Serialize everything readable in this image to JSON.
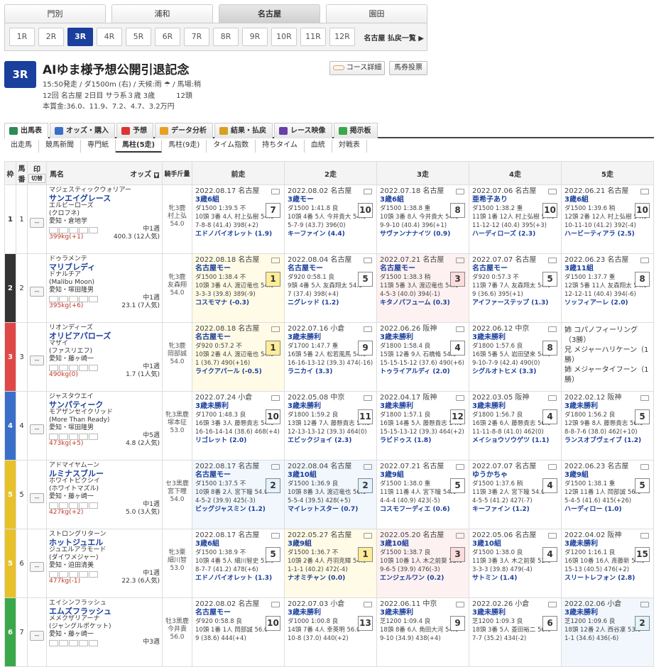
{
  "venue_tabs": [
    "門別",
    "浦和",
    "名古屋",
    "園田"
  ],
  "active_venue": 2,
  "races": [
    "1R",
    "2R",
    "3R",
    "4R",
    "5R",
    "6R",
    "7R",
    "8R",
    "9R",
    "10R",
    "11R",
    "12R"
  ],
  "active_race": 2,
  "payout_link": "名古屋 払戻一覧 ▶",
  "race": {
    "num": "3R",
    "name": "AIゆま様予想公開引退記念",
    "line1": "15:50発走 / ダ1500m (右) / 天候:雨 ☂ / 馬場:稍",
    "line2": "12回 名古屋 2日目 サラ系３歳 3歳　　　12頭",
    "line3": "本賞金:36.0、11.9、7.2、4.7、3.2万円"
  },
  "side_buttons": {
    "course": "コース詳細",
    "ticket": "馬券投票"
  },
  "main_tabs": [
    "出馬表",
    "オッズ・購入",
    "予想",
    "データ分析",
    "結果・払戻",
    "レース映像",
    "掲示板"
  ],
  "sub_tabs": [
    "出走馬",
    "競馬新聞",
    "専門紙",
    "馬柱(5走)",
    "馬柱(9走)",
    "タイム指数",
    "持ちタイム",
    "血統",
    "対戦表"
  ],
  "headers": {
    "waku": "枠",
    "umaban": "馬番",
    "mark": "印",
    "mark2": "切替",
    "horse": "馬名",
    "odds": "オッズ",
    "jockey": "騎手斤量",
    "p1": "前走",
    "p2": "2走",
    "p3": "3走",
    "p4": "4走",
    "p5": "5走"
  },
  "horses": [
    {
      "waku": "1",
      "wcol": "#ffffff",
      "wtxt": "#333",
      "no": "1",
      "sire": "マジェスティックウォリアー",
      "name": "サンエイグレース",
      "dam": "エルビーローズ",
      "damsire": "(クロフネ)",
      "trainer": "愛知・倉地学",
      "week": "中1週",
      "weight": "399kg(+1)",
      "odds": "400.3 (12人気)",
      "jk": "牝3鹿",
      "jk2": "村上弘",
      "jk3": "54.0",
      "past": [
        {
          "bg": "",
          "date": "2022.08.17 名古屋",
          "cls": "3歳6組",
          "pos": "7",
          "l1": "ダ1500 1:39.5 不",
          "l2": "10頭 3番 4人 村上弘樹 54.0",
          "l3": "7-8-8 (41.4) 398(+2)",
          "w": "エドノバイオレット (1.9)"
        },
        {
          "bg": "",
          "date": "2022.08.02 名古屋",
          "cls": "3歳モー",
          "pos": "10",
          "l1": "ダ1500 1:41.8 良",
          "l2": "10頭 4番 5人 今井貴大 54.0",
          "l3": "5-7-9 (43.7) 396(0)",
          "w": "キーファイン (4.4)"
        },
        {
          "bg": "",
          "date": "2022.07.18 名古屋",
          "cls": "3歳6組",
          "pos": "8",
          "l1": "ダ1500 1:38.8 重",
          "l2": "10頭 3番 8人 今井貴大 54.0",
          "l3": "9-9-10 (40.4) 396(+1)",
          "w": "サヴァンナナイツ (0.9)"
        },
        {
          "bg": "",
          "date": "2022.07.06 名古屋",
          "cls": "亜希子あり",
          "pos": "10",
          "l1": "ダ1500 1:38.2 重",
          "l2": "11頭 1番 12人 村上弘樹 54.0",
          "l3": "11-12-12 (40.4) 395(+3)",
          "w": "ハーディローズ (2.3)"
        },
        {
          "bg": "",
          "date": "2022.06.21 名古屋",
          "cls": "3歳6組",
          "pos": "10",
          "l1": "ダ1500 1:39.6 稍",
          "l2": "12頭 2番 12人 村上弘樹 54.0",
          "l3": "10-11-10 (41.2) 392(-4)",
          "w": "ハービーティアラ (2.5)"
        }
      ]
    },
    {
      "waku": "2",
      "wcol": "#333333",
      "wtxt": "#fff",
      "no": "2",
      "sire": "ドゥラメンテ",
      "name": "マリブレディ",
      "dam": "ドナルチア",
      "damsire": "(Malibu Moon)",
      "trainer": "愛知・塚田隆男",
      "week": "中1週",
      "weight": "395kg(+6)",
      "odds": "23.1 (7人気)",
      "jk": "牝3鹿",
      "jk2": "友森翔",
      "jk3": "54.0",
      "past": [
        {
          "bg": "bg1",
          "date": "2022.08.18 名古屋",
          "cls": "名古屋モー",
          "pos": "1",
          "l1": "ダ1500 1:38.4 不",
          "l2": "10頭 3番 4人 渡辺竜也 54.0",
          "l3": "3-3-3 (39.8) 389(-9)",
          "w": "コスモマナ (-0.3)"
        },
        {
          "bg": "",
          "date": "2022.08.04 名古屋",
          "cls": "名古屋モー",
          "pos": "5",
          "l1": "ダ920 0:58.1 良",
          "l2": "9頭 4番 5人 友森翔太 54.0",
          "l3": "7 (37.4) 398(+4)",
          "w": "ニグレッド (1.2)"
        },
        {
          "bg": "bg3",
          "date": "2022.07.21 名古屋",
          "cls": "名古屋モー",
          "pos": "3",
          "l1": "ダ1500 1:38.3 稍",
          "l2": "11頭 5番 3人 渡辺竜也 54.0",
          "l3": "4-5-3 (40.0) 394(-1)",
          "w": "キタノパフューム (0.3)"
        },
        {
          "bg": "",
          "date": "2022.07.07 名古屋",
          "cls": "名古屋モー",
          "pos": "5",
          "l1": "ダ920 0:57.3 不",
          "l2": "11頭 7番 7人 友森翔太 54.0",
          "l3": "9 (36.6) 395(+1)",
          "w": "アイファーステップ (1.3)"
        },
        {
          "bg": "",
          "date": "2022.06.23 名古屋",
          "cls": "3歳11組",
          "pos": "8",
          "l1": "ダ1500 1:37.7 重",
          "l2": "12頭 5番 11人 友森翔太 54.0",
          "l3": "12-12-11 (40.4) 394(-6)",
          "w": "ソッフィアーレ (2.0)"
        }
      ]
    },
    {
      "waku": "3",
      "wcol": "#e04848",
      "wtxt": "#fff",
      "no": "3",
      "sire": "リオンディーズ",
      "name": "オリビアパローズ",
      "dam": "マザイ",
      "damsire": "(ファスリエフ)",
      "trainer": "愛知・藤ヶ崎一",
      "week": "中1週",
      "weight": "490kg(0)",
      "odds": "1.7 (1人気)",
      "jk": "牝3鹿",
      "jk2": "岡部誠",
      "jk3": "54.0",
      "past": [
        {
          "bg": "bg1",
          "date": "2022.08.18 名古屋",
          "cls": "名古屋モー",
          "pos": "1",
          "l1": "ダ920 0:57.2 不",
          "l2": "10頭 2番 4人 渡辺竜也 54.0",
          "l3": "1 (36.7) 490(+16)",
          "w": "ライクアパール (-0.5)"
        },
        {
          "bg": "",
          "date": "2022.07.16 小倉",
          "cls": "3歳未勝利",
          "pos": "9",
          "l1": "ダ1700 1:47.7 重",
          "l2": "16頭 5番 2人 松若風馬 54.0",
          "l3": "16-16-13-12 (39.3) 474(-16)",
          "w": "ラニカイ (3.3)"
        },
        {
          "bg": "",
          "date": "2022.06.26 阪神",
          "cls": "3歳未勝利",
          "pos": "4",
          "l1": "ダ1800 1:58.4 良",
          "l2": "15頭 12番 9人 石橋脩 54.0",
          "l3": "15-15-15-12 (37.6) 490(+6)",
          "w": "トゥライアルディ (2.0)"
        },
        {
          "bg": "",
          "date": "2022.06.12 中京",
          "cls": "3歳未勝利",
          "pos": "8",
          "l1": "ダ1800 1:57.6 良",
          "l2": "16頭 5番 5人 岩田望来 54.0",
          "l3": "9-10-7-9 (42.4) 490(0)",
          "w": "シグルオトヒメ (3.3)"
        },
        {
          "sib": [
            "姉 コパノフィーリング",
            "（3勝）",
            "兄 メジャーハリケーン（1勝）",
            "姉 メジャータイフーン（1勝）"
          ]
        }
      ]
    },
    {
      "waku": "4",
      "wcol": "#3a6fc9",
      "wtxt": "#fff",
      "no": "4",
      "sire": "ジャスタウエイ",
      "name": "サンパティーク",
      "dam": "モアザンセイクリッド",
      "damsire": "(More Than Ready)",
      "trainer": "愛知・塚田隆男",
      "week": "中5週",
      "weight": "473kg(+5)",
      "odds": "4.8 (2人気)",
      "jk": "牝3黒鹿",
      "jk2": "塚本征",
      "jk3": "53.0",
      "past": [
        {
          "bg": "",
          "date": "2022.07.24 小倉",
          "cls": "3歳未勝利",
          "pos": "10",
          "l1": "ダ1700 1:48.3 良",
          "l2": "16頭 3番 3人 藤懸貴志 54.0",
          "l3": "16-16-14-14 (38.6) 468(+4)",
          "w": "リゴレット (2.0)"
        },
        {
          "bg": "",
          "date": "2022.05.08 中京",
          "cls": "3歳未勝利",
          "pos": "11",
          "l1": "ダ1800 1:59.2 良",
          "l2": "13頭 12番 7人 藤懸貴志 54.0",
          "l3": "12-13-13-12 (39.3) 464(0)",
          "w": "エビックジョイ (2.3)"
        },
        {
          "bg": "",
          "date": "2022.04.17 阪神",
          "cls": "3歳未勝利",
          "pos": "12",
          "l1": "ダ1800 1:57.1 良",
          "l2": "16頭 14番 5人 藤懸貴志 54.0",
          "l3": "15-15-13-12 (39.3) 464(+2)",
          "w": "ラビドゥス (1.8)"
        },
        {
          "bg": "",
          "date": "2022.03.05 阪神",
          "cls": "3歳未勝利",
          "pos": "4",
          "l1": "ダ1800 1:56.7 良",
          "l2": "16頭 2番 6人 藤懸貴志 56.0",
          "l3": "11-11-8-8 (41.0) 462(0)",
          "w": "メイショウソウゲツ (1.1)"
        },
        {
          "bg": "",
          "date": "2022.02.12 阪神",
          "cls": "3歳未勝利",
          "pos": "5",
          "l1": "ダ1800 1:56.2 良",
          "l2": "12頭 9番 8人 藤懸貴志 56.0",
          "l3": "8-8-7-6 (38.0) 462(+10)",
          "w": "ランスオブヴェイブ (1.2)"
        }
      ]
    },
    {
      "waku": "5",
      "wcol": "#e8c12a",
      "wtxt": "#fff",
      "no": "5",
      "sire": "アドマイヤムーン",
      "name": "ルミナスブルー",
      "dam": "ホワイトピクシイ",
      "damsire": "(ホワイトマズル)",
      "trainer": "愛知・藤ヶ崎一",
      "week": "中1週",
      "weight": "427kg(+2)",
      "odds": "5.0 (3人気)",
      "jk": "セ3黒鹿",
      "jk2": "宮下瞳",
      "jk3": "54.0",
      "past": [
        {
          "bg": "bg2",
          "date": "2022.08.17 名古屋",
          "cls": "名古屋モー",
          "pos": "2",
          "l1": "ダ1500 1:37.5 不",
          "l2": "10頭 8番 2人 宮下瞳 54.0",
          "l3": "4-5-2 (39.9) 425(-3)",
          "w": "ビッグジャスミン (1.2)"
        },
        {
          "bg": "bg2",
          "date": "2022.08.04 名古屋",
          "cls": "3歳10組",
          "pos": "2",
          "l1": "ダ1500 1:36.9 良",
          "l2": "10頭 8番 3人 渡辺竜也 56.0",
          "l3": "5-5-4 (39.5) 428(+5)",
          "w": "マイレットスター (0.7)"
        },
        {
          "bg": "",
          "date": "2022.07.21 名古屋",
          "cls": "3歳9組",
          "pos": "5",
          "l1": "ダ1500 1:38.0 重",
          "l2": "11頭 11番 4人 宮下瞳 54.0",
          "l3": "4-4-4 (40.9) 423(-5)",
          "w": "コスモフーディエ (0.6)"
        },
        {
          "bg": "",
          "date": "2022.07.07 名古屋",
          "cls": "ゆうかちゃ",
          "pos": "4",
          "l1": "ダ1500 1:37.6 稍",
          "l2": "11頭 3番 2人 宮下瞳 54.0",
          "l3": "4-5-5 (41.2) 427(-7)",
          "w": "キーファイン (1.2)"
        },
        {
          "bg": "",
          "date": "2022.06.23 名古屋",
          "cls": "3歳9組",
          "pos": "5",
          "l1": "ダ1500 1:38.1 重",
          "l2": "12頭 11番 1人 岡部誠 56.0",
          "l3": "5-4-5 (41.6) 415(+26)",
          "w": "ハーディロー (1.0)"
        }
      ]
    },
    {
      "waku": "5",
      "wcol": "#e8c12a",
      "wtxt": "#fff",
      "no": "6",
      "sire": "ストロングリターン",
      "name": "ホットジュエル",
      "dam": "ジュエルアラモード",
      "damsire": "(ダイワメジャー)",
      "trainer": "愛知・迫田清美",
      "week": "中1週",
      "weight": "477kg(-1)",
      "odds": "22.3 (6人気)",
      "jk": "牝3栗",
      "jk2": "細川智",
      "jk3": "53.0",
      "past": [
        {
          "bg": "",
          "date": "2022.08.17 名古屋",
          "cls": "3歳6組",
          "pos": "5",
          "l1": "ダ1500 1:38.9 不",
          "l2": "10頭 4番 5人 細川智史 53.0",
          "l3": "8-7-7 (41.2) 478(+6)",
          "w": "エドノバイオレット (1.3)"
        },
        {
          "bg": "bg1",
          "date": "2022.05.27 名古屋",
          "cls": "3歳9組",
          "pos": "1",
          "l1": "ダ1500 1:36.7 不",
          "l2": "10頭 2番 4人 丹羽克輝 54.0",
          "l3": "1-1-1 (40.2) 472(-4)",
          "w": "ナオミチャン (0.0)"
        },
        {
          "bg": "bg3",
          "date": "2022.05.20 名古屋",
          "cls": "3歳10組",
          "pos": "3",
          "l1": "ダ1500 1:38.7 良",
          "l2": "10頭 10番 1人 木之前葵 52.0",
          "l3": "9-6-5 (39.9) 476(-3)",
          "w": "エンジェルワン (0.2)"
        },
        {
          "bg": "",
          "date": "2022.05.06 名古屋",
          "cls": "3歳10組",
          "pos": "4",
          "l1": "ダ1500 1:38.0 良",
          "l2": "11頭 3番 3人 木之前葵 52.0",
          "l3": "3-3-3 (39.8) 479(-4)",
          "w": "サトミン (1.4)"
        },
        {
          "bg": "",
          "date": "2022.04.02 阪神",
          "cls": "3歳未勝利",
          "pos": "15",
          "l1": "ダ1200 1:16.1 良",
          "l2": "16頭 10番 16人 斎藤新 54.0",
          "l3": "15-13 (40.5) 476(+2)",
          "w": "スリートレフォン (2.8)"
        }
      ]
    },
    {
      "waku": "6",
      "wcol": "#3aa84a",
      "wtxt": "#fff",
      "no": "7",
      "sire": "エイシンフラッシュ",
      "name": "エムズフラッシュ",
      "dam": "メメクザリアーナ",
      "damsire": "(ジャングルポケット)",
      "trainer": "愛知・藤ヶ崎一",
      "week": "中3週",
      "weight": "",
      "odds": "",
      "jk": "牡3黒鹿",
      "jk2": "今井貴",
      "jk3": "56.0",
      "past": [
        {
          "bg": "",
          "date": "2022.08.02 名古屋",
          "cls": "名古屋モー",
          "pos": "10",
          "l1": "ダ920 0:58.8 良",
          "l2": "10頭 1番 1人 岡部誠 56.0",
          "l3": "9 (38.6) 444(+4)",
          "w": ""
        },
        {
          "bg": "",
          "date": "2022.07.03 小倉",
          "cls": "3歳未勝利",
          "pos": "13",
          "l1": "ダ1000 1:00.8 良",
          "l2": "14頭 7番 4人 幸英明 56.0",
          "l3": "10-8 (37.0) 440(+2)",
          "w": ""
        },
        {
          "bg": "",
          "date": "2022.06.11 中京",
          "cls": "3歳未勝利",
          "pos": "9",
          "l1": "芝1200 1:09.4 良",
          "l2": "18頭 8番 6人 角田大河 54.0",
          "l3": "9-10 (34.9) 438(+4)",
          "w": ""
        },
        {
          "bg": "",
          "date": "2022.02.26 小倉",
          "cls": "3歳未勝利",
          "pos": "6",
          "l1": "芝1200 1:09.3 良",
          "l2": "18頭 3番 5人 菱田裕二 56.0",
          "l3": "7-7 (35.2) 434(-2)",
          "w": ""
        },
        {
          "bg": "bg2",
          "date": "2022.02.06 小倉",
          "cls": "3歳未勝利",
          "pos": "2",
          "l1": "芝1200 1:09.6 良",
          "l2": "18頭 12番 2人 西谷凜 53.0",
          "l3": "1-1 (34.6) 436(-6)",
          "w": ""
        }
      ]
    }
  ],
  "colors": {
    "accent": "#1a3f9c",
    "win": "#ffec99"
  }
}
